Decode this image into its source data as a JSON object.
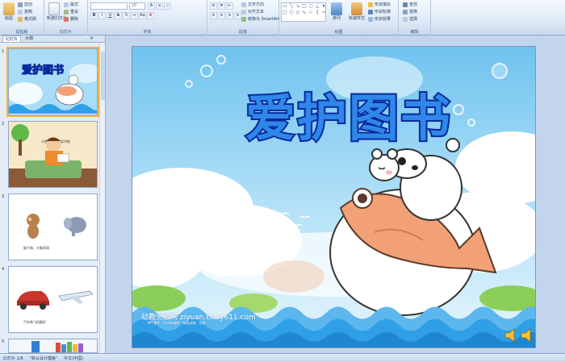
{
  "ribbon": {
    "clipboard": {
      "paste": "粘贴",
      "cut": "剪切",
      "copy": "复制",
      "format_painter": "格式刷",
      "label": "剪贴板"
    },
    "slides": {
      "new_slide": "新建幻灯片",
      "layout": "版式",
      "reset": "重设",
      "delete": "删除",
      "label": "幻灯片"
    },
    "font": {
      "size": "20",
      "label": "字体"
    },
    "paragraph": {
      "text_direction": "文字方向",
      "align_text": "对齐文本",
      "convert_smartart": "转换为 SmartArt",
      "label": "段落"
    },
    "drawing": {
      "arrange": "排列",
      "quick_styles": "快速样式",
      "shape_fill": "形状填充",
      "shape_outline": "形状轮廓",
      "shape_effects": "形状效果",
      "label": "绘图"
    },
    "editing": {
      "find": "查找",
      "replace": "替换",
      "select": "选择",
      "label": "编辑"
    }
  },
  "left_pane": {
    "tab_slides": "幻灯片",
    "tab_outline": "大纲",
    "close": "×",
    "thumbnails": [
      {
        "num": "1",
        "caption": "爱护图书"
      },
      {
        "num": "2",
        "caption": "小朋友，我们读书啦"
      },
      {
        "num": "3",
        "caption": "猴子和，大象哥哥"
      },
      {
        "num": "4",
        "caption": "汽车和飞机都好"
      },
      {
        "num": "5",
        "caption": ""
      }
    ]
  },
  "slide": {
    "title": "爱护图书",
    "watermark": "幼教资源网 ziyuan.baby611.com",
    "watermark_sub": "PPT课件 · FLASH课件 · 教案试卷 · 试卷"
  },
  "status": {
    "slide_info": "幻灯片 1/8",
    "theme": "\"默认设计模板\"",
    "language": "中文(中国)"
  },
  "colors": {
    "ribbon": "#dbe7f5",
    "sky": "#8fd0f3",
    "title_fill": "#2f87e8",
    "title_outline": "#0a2a9c",
    "fish": "#f2a176",
    "wave": "#2f9fe6"
  }
}
